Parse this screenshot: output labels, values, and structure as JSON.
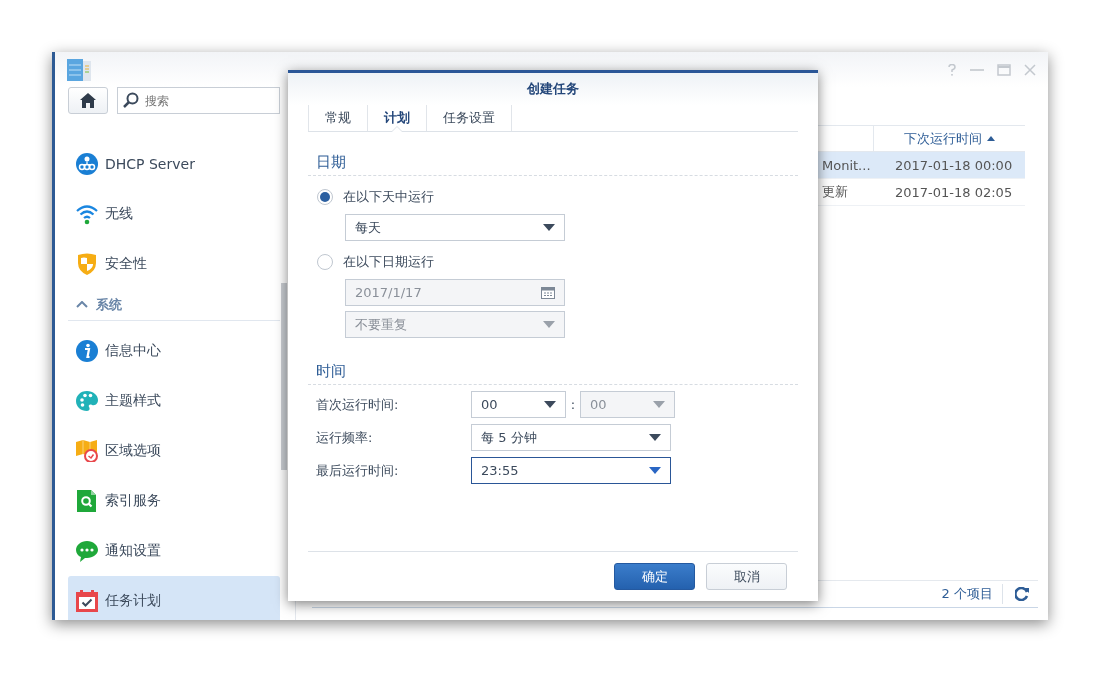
{
  "search": {
    "placeholder": "搜索"
  },
  "sidebar": {
    "items": [
      {
        "kind": "item",
        "label": "DHCP Server",
        "selected": false
      },
      {
        "kind": "item",
        "label": "无线",
        "selected": false
      },
      {
        "kind": "item",
        "label": "安全性",
        "selected": false
      },
      {
        "kind": "section",
        "label": "系统",
        "expanded": true
      },
      {
        "kind": "item",
        "label": "信息中心",
        "selected": false
      },
      {
        "kind": "item",
        "label": "主题样式",
        "selected": false
      },
      {
        "kind": "item",
        "label": "区域选项",
        "selected": false
      },
      {
        "kind": "item",
        "label": "索引服务",
        "selected": false
      },
      {
        "kind": "item",
        "label": "通知设置",
        "selected": false
      },
      {
        "kind": "item",
        "label": "任务计划",
        "selected": true
      }
    ]
  },
  "table": {
    "columns": [
      {},
      {
        "label": "下次运行时间",
        "sorted_ascending": true
      }
    ],
    "rows": [
      {
        "selected": true,
        "cells": [
          "Monit...",
          "2017-01-18 00:00"
        ]
      },
      {
        "selected": false,
        "cells": [
          "更新",
          "2017-01-18 02:05"
        ]
      }
    ]
  },
  "status_bar": {
    "count": "2 个项目"
  },
  "dialog": {
    "title": "创建任务",
    "tabs": [
      {
        "label": "常规",
        "selected": false
      },
      {
        "label": "计划",
        "selected": true
      },
      {
        "label": "任务设置",
        "selected": false
      }
    ],
    "date_section": {
      "title": "日期",
      "options": [
        {
          "label": "在以下天中运行",
          "selected": true,
          "fields": [
            {
              "kind": "dropdown",
              "value": "每天",
              "disabled": false,
              "focused": false
            }
          ]
        },
        {
          "label": "在以下日期运行",
          "selected": false,
          "fields": [
            {
              "kind": "date",
              "value": "2017/1/17",
              "disabled": true,
              "focused": false
            },
            {
              "kind": "dropdown",
              "value": "不要重复",
              "disabled": true,
              "focused": false
            }
          ]
        }
      ]
    },
    "time_section": {
      "title": "时间",
      "rows": [
        {
          "label": "首次运行时间:",
          "separator": ":",
          "fields": [
            {
              "kind": "dropdown",
              "value": "00",
              "disabled": false,
              "focused": false
            },
            {
              "kind": "dropdown",
              "value": "00",
              "disabled": true,
              "focused": false
            }
          ]
        },
        {
          "label": "运行频率:",
          "fields": [
            {
              "kind": "dropdown",
              "value": "每 5 分钟",
              "disabled": false,
              "focused": false
            }
          ]
        },
        {
          "label": "最后运行时间:",
          "fields": [
            {
              "kind": "dropdown",
              "value": "23:55",
              "disabled": false,
              "focused": true
            }
          ]
        }
      ]
    },
    "buttons": [
      {
        "label": "确定",
        "primary": true
      },
      {
        "label": "取消",
        "primary": false
      }
    ]
  }
}
